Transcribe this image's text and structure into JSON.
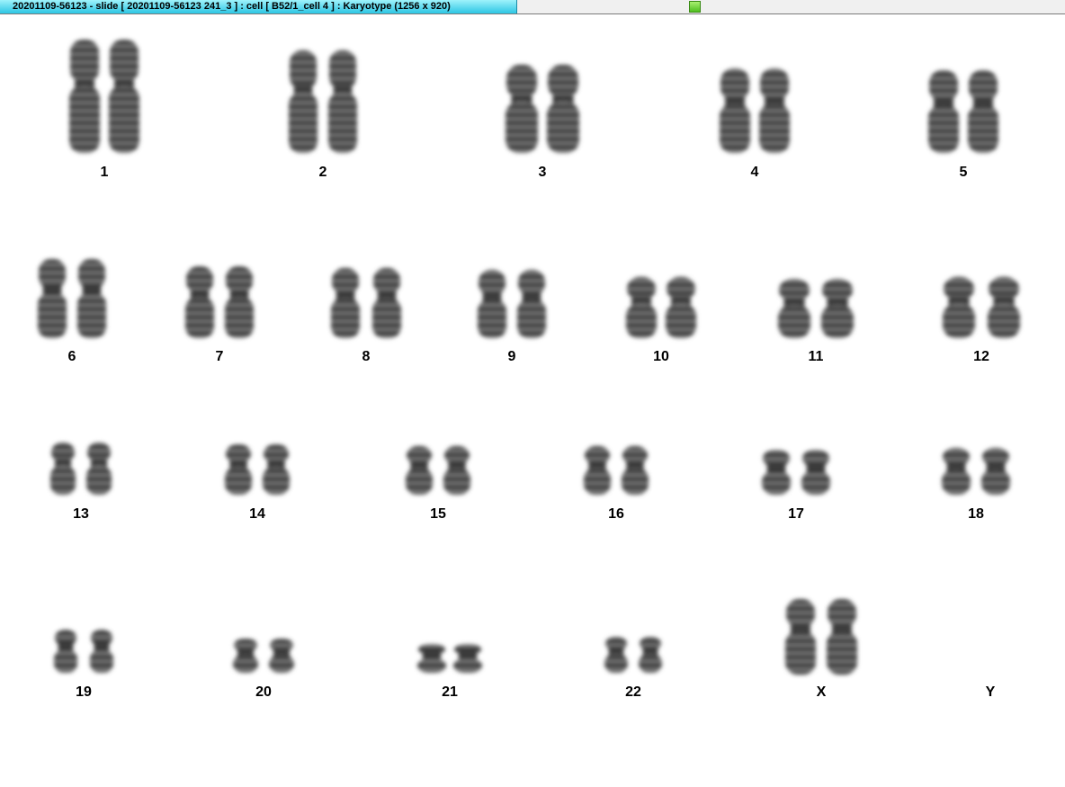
{
  "window": {
    "title": "20201109-56123 - slide [ 20201109-56123 241_3 ] : cell [ B52/1_cell 4 ] : Karyotype  (1256 x 920)",
    "status_indicator_color": "#5ccc2a"
  },
  "karyotype": {
    "chromosomes": [
      {
        "label": "1",
        "count": 2
      },
      {
        "label": "2",
        "count": 2
      },
      {
        "label": "3",
        "count": 2
      },
      {
        "label": "4",
        "count": 2
      },
      {
        "label": "5",
        "count": 2
      },
      {
        "label": "6",
        "count": 2
      },
      {
        "label": "7",
        "count": 2
      },
      {
        "label": "8",
        "count": 2
      },
      {
        "label": "9",
        "count": 2
      },
      {
        "label": "10",
        "count": 2
      },
      {
        "label": "11",
        "count": 2
      },
      {
        "label": "12",
        "count": 2
      },
      {
        "label": "13",
        "count": 2
      },
      {
        "label": "14",
        "count": 2
      },
      {
        "label": "15",
        "count": 2
      },
      {
        "label": "16",
        "count": 2
      },
      {
        "label": "17",
        "count": 2
      },
      {
        "label": "18",
        "count": 2
      },
      {
        "label": "19",
        "count": 2
      },
      {
        "label": "20",
        "count": 2
      },
      {
        "label": "21",
        "count": 2
      },
      {
        "label": "22",
        "count": 2
      },
      {
        "label": "X",
        "count": 2
      },
      {
        "label": "Y",
        "count": 0
      }
    ]
  }
}
